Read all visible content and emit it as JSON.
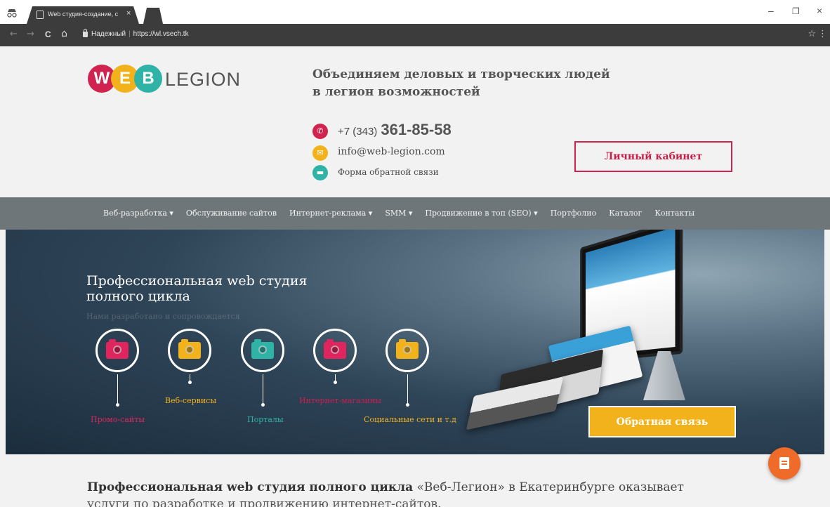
{
  "browser": {
    "tab_title": "Web студия-создание, с",
    "tab_close": "×",
    "address_secure_label": "Надежный",
    "address_url": "https://wl.vsech.tk",
    "controls": {
      "minimize": "–",
      "restore": "❐",
      "close": "×"
    },
    "nav": {
      "back": "←",
      "forward": "→",
      "reload": "C",
      "home": "⌂"
    },
    "bookmark": "☆",
    "menu": "⋮"
  },
  "header": {
    "logo_letters": [
      "W",
      "E",
      "B"
    ],
    "logo_text": "LEGION",
    "tagline_line1": "Объединяем деловых и творческих людей",
    "tagline_line2": "в легион возможностей",
    "phone_prefix": "+7 (343)",
    "phone_number": "361-85-58",
    "email": "info@web-legion.com",
    "feedback_form": "Форма обратной связи",
    "cabinet_button": "Личный кабинет"
  },
  "nav": {
    "items": [
      "Веб-разработка ▾",
      "Обслуживание сайтов",
      "Интернет-реклама ▾",
      "SMM ▾",
      "Продвижение в топ (SEO) ▾",
      "Портфолио",
      "Каталог",
      "Контакты"
    ]
  },
  "hero": {
    "title_line1": "Профессиональная web студия",
    "title_line2": "полного цикла",
    "subtitle": "Нами разработано и сопровождается",
    "services": [
      {
        "label": "Промо-сайты",
        "color": "#e0245e"
      },
      {
        "label": "Веб-сервисы",
        "color": "#f2b21c"
      },
      {
        "label": "Порталы",
        "color": "#2fb3a6"
      },
      {
        "label": "Интернет-магазины",
        "color": "#e0245e"
      },
      {
        "label": "Социальные сети и т.д",
        "color": "#f2b21c"
      }
    ],
    "feedback_button": "Обратная связь"
  },
  "intro": {
    "bold": "Профессиональная web студия полного цикла",
    "rest": " «Веб-Легион» в Екатеринбурге оказывает",
    "line2": "услуги по разработке и продвижению интернет-сайтов."
  },
  "colors": {
    "accent_red": "#d0234f",
    "accent_yellow": "#f2b21c",
    "accent_teal": "#2fb3a6",
    "nav_bg": "#6f7679",
    "chat_button": "#ef6b2a"
  }
}
